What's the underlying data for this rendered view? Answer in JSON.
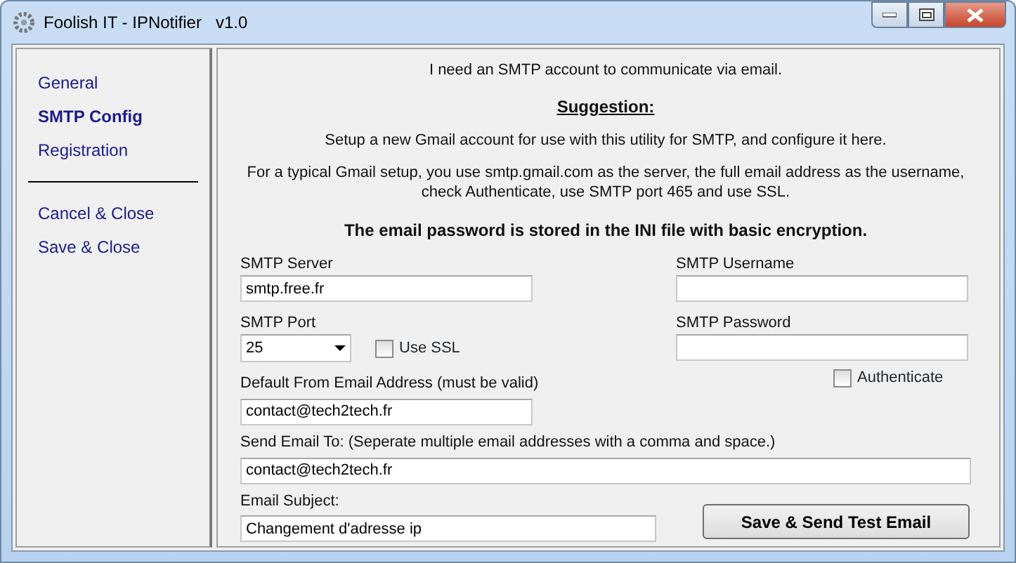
{
  "window": {
    "title": "Foolish IT - IPNotifier   v1.0"
  },
  "sidebar": {
    "items": [
      {
        "label": "General",
        "selected": false,
        "kind": "nav"
      },
      {
        "label": "SMTP Config",
        "selected": true,
        "kind": "nav"
      },
      {
        "label": "Registration",
        "selected": false,
        "kind": "nav"
      },
      {
        "label": "Cancel & Close",
        "selected": false,
        "kind": "action"
      },
      {
        "label": "Save & Close",
        "selected": false,
        "kind": "action"
      }
    ]
  },
  "intro": {
    "line": "I need an SMTP account to communicate via email.",
    "heading": "Suggestion:",
    "suggestion": "Setup a new Gmail account for use with this utility for SMTP, and configure it here.",
    "gmail_lines": [
      "For a typical Gmail setup, you use smtp.gmail.com as the server, the full email address as the username,",
      "check Authenticate, use SMTP port 465 and use SSL."
    ],
    "warning": "The email password is stored in the INI file with basic encryption."
  },
  "form": {
    "smtp_server": {
      "label": "SMTP Server",
      "value": "smtp.free.fr"
    },
    "smtp_username": {
      "label": "SMTP Username"
    },
    "smtp_port": {
      "label": "SMTP Port",
      "value": "25"
    },
    "use_ssl": {
      "label": "Use SSL",
      "checked": false
    },
    "smtp_password": {
      "label": "SMTP Password"
    },
    "authenticate": {
      "label": "Authenticate",
      "checked": false
    },
    "from_address": {
      "label": "Default From Email Address (must be valid)",
      "value": "contact@tech2tech.fr"
    },
    "send_to": {
      "label": "Send Email To:  (Seperate multiple email addresses with a comma and space.)",
      "value": "contact@tech2tech.fr"
    },
    "subject": {
      "label": "Email Subject:",
      "value": "Changement d'adresse ip"
    },
    "test_button": "Save & Send Test Email"
  }
}
